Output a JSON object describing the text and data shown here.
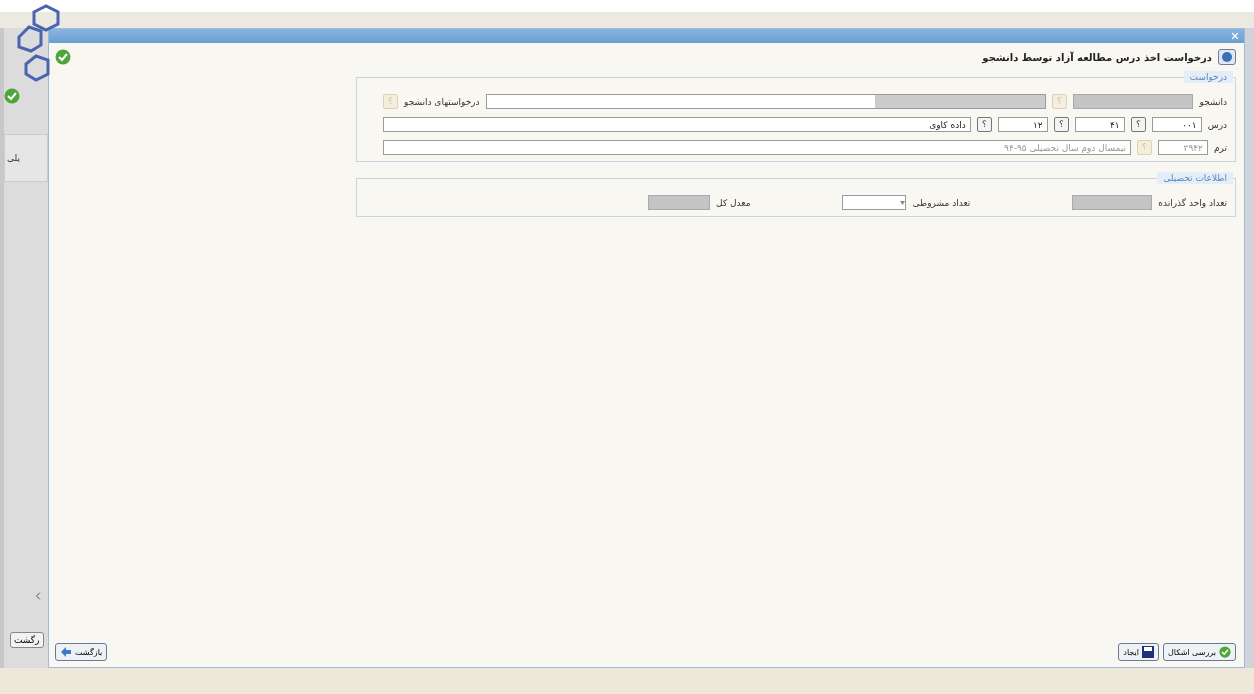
{
  "background": {
    "tab_label": "یلی",
    "back_button": "رگشت"
  },
  "dialog": {
    "title": "درخواست اخذ درس مطالعه آزاد توسط دانشجو",
    "sections": [
      {
        "legend": "درخواست",
        "rows": [
          {
            "label": "دانشجو",
            "items": [
              {
                "kind": "masked"
              },
              {
                "kind": "lookup",
                "symbol": "؟",
                "disabled": true
              },
              {
                "kind": "masked_input"
              },
              {
                "kind": "label",
                "text": "درخواستهای دانشجو"
              },
              {
                "kind": "lookup",
                "symbol": "؟",
                "disabled": true
              }
            ]
          },
          {
            "label": "درس",
            "items": [
              {
                "kind": "code",
                "value": "۰۰۱",
                "disabled": false
              },
              {
                "kind": "lookup",
                "symbol": "؟",
                "disabled": false
              },
              {
                "kind": "code",
                "value": "۴۱",
                "disabled": false
              },
              {
                "kind": "lookup",
                "symbol": "؟",
                "disabled": false
              },
              {
                "kind": "code",
                "value": "۱۲",
                "disabled": false
              },
              {
                "kind": "lookup",
                "symbol": "؟",
                "disabled": false
              },
              {
                "kind": "text",
                "value": "داده کاوی",
                "disabled": false
              }
            ]
          },
          {
            "label": "ترم",
            "items": [
              {
                "kind": "code",
                "value": "۳۹۴۲",
                "disabled": true
              },
              {
                "kind": "lookup",
                "symbol": "؟",
                "disabled": true
              },
              {
                "kind": "text",
                "value": "نیمسال دوم سال تحصیلی ۹۵-۹۴",
                "disabled": true
              }
            ]
          }
        ]
      },
      {
        "legend": "اطلاعات تحصیلی",
        "rows": [
          {
            "label": "تعداد واحد گذرانده",
            "items": [
              {
                "kind": "masked"
              },
              {
                "kind": "gap"
              },
              {
                "kind": "label",
                "text": "تعداد مشروطی"
              },
              {
                "kind": "select"
              },
              {
                "kind": "gap"
              },
              {
                "kind": "label",
                "text": "معدل کل"
              },
              {
                "kind": "masked"
              }
            ]
          }
        ]
      }
    ],
    "buttons": [
      {
        "kind": "check",
        "label": "بررسی اشکال"
      },
      {
        "kind": "save",
        "label": "ایجاد"
      }
    ],
    "back_button": "بازگشت"
  }
}
